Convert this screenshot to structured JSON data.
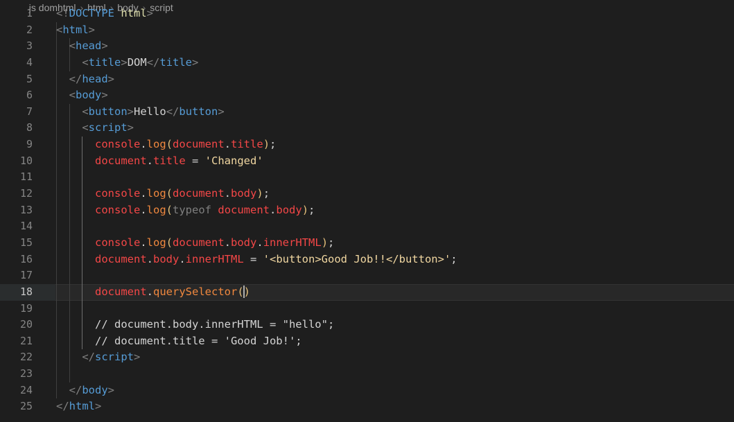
{
  "breadcrumb": {
    "file": "js domhtml",
    "items": [
      "html",
      "body",
      "script"
    ]
  },
  "editor": {
    "lines": [
      {
        "n": "1",
        "tokens": [
          [
            "tag-b",
            "<!"
          ],
          [
            "doctype",
            "DOCTYPE"
          ],
          [
            "txt",
            " "
          ],
          [
            "attr",
            "html"
          ],
          [
            "tag-b",
            ">"
          ]
        ]
      },
      {
        "n": "2",
        "tokens": [
          [
            "tag-b",
            "<"
          ],
          [
            "tag",
            "html"
          ],
          [
            "tag-b",
            ">"
          ]
        ]
      },
      {
        "n": "3",
        "tokens": [
          [
            "txt",
            "  "
          ],
          [
            "tag-b",
            "<"
          ],
          [
            "tag",
            "head"
          ],
          [
            "tag-b",
            ">"
          ]
        ]
      },
      {
        "n": "4",
        "tokens": [
          [
            "txt",
            "    "
          ],
          [
            "tag-b",
            "<"
          ],
          [
            "tag",
            "title"
          ],
          [
            "tag-b",
            ">"
          ],
          [
            "txt",
            "DOM"
          ],
          [
            "tag-b",
            "</"
          ],
          [
            "tag",
            "title"
          ],
          [
            "tag-b",
            ">"
          ]
        ]
      },
      {
        "n": "5",
        "tokens": [
          [
            "txt",
            "  "
          ],
          [
            "tag-b",
            "</"
          ],
          [
            "tag",
            "head"
          ],
          [
            "tag-b",
            ">"
          ]
        ]
      },
      {
        "n": "6",
        "tokens": [
          [
            "txt",
            "  "
          ],
          [
            "tag-b",
            "<"
          ],
          [
            "tag",
            "body"
          ],
          [
            "tag-b",
            ">"
          ]
        ]
      },
      {
        "n": "7",
        "tokens": [
          [
            "txt",
            "    "
          ],
          [
            "tag-b",
            "<"
          ],
          [
            "tag",
            "button"
          ],
          [
            "tag-b",
            ">"
          ],
          [
            "txt",
            "Hello"
          ],
          [
            "tag-b",
            "</"
          ],
          [
            "tag",
            "button"
          ],
          [
            "tag-b",
            ">"
          ]
        ]
      },
      {
        "n": "8",
        "tokens": [
          [
            "txt",
            "    "
          ],
          [
            "tag-b",
            "<"
          ],
          [
            "tag",
            "script"
          ],
          [
            "tag-b",
            ">"
          ]
        ]
      },
      {
        "n": "9",
        "tokens": [
          [
            "txt",
            "      "
          ],
          [
            "var",
            "console"
          ],
          [
            "punc",
            "."
          ],
          [
            "fn",
            "log"
          ],
          [
            "paren",
            "("
          ],
          [
            "var",
            "document"
          ],
          [
            "punc",
            "."
          ],
          [
            "prop",
            "title"
          ],
          [
            "paren",
            ")"
          ],
          [
            "punc",
            ";"
          ]
        ]
      },
      {
        "n": "10",
        "tokens": [
          [
            "txt",
            "      "
          ],
          [
            "var",
            "document"
          ],
          [
            "punc",
            "."
          ],
          [
            "prop",
            "title"
          ],
          [
            "punc",
            " = "
          ],
          [
            "str",
            "'Changed'"
          ]
        ]
      },
      {
        "n": "11",
        "tokens": []
      },
      {
        "n": "12",
        "tokens": [
          [
            "txt",
            "      "
          ],
          [
            "var",
            "console"
          ],
          [
            "punc",
            "."
          ],
          [
            "fn",
            "log"
          ],
          [
            "paren",
            "("
          ],
          [
            "var",
            "document"
          ],
          [
            "punc",
            "."
          ],
          [
            "prop",
            "body"
          ],
          [
            "paren",
            ")"
          ],
          [
            "punc",
            ";"
          ]
        ]
      },
      {
        "n": "13",
        "tokens": [
          [
            "txt",
            "      "
          ],
          [
            "var",
            "console"
          ],
          [
            "punc",
            "."
          ],
          [
            "fn",
            "log"
          ],
          [
            "paren",
            "("
          ],
          [
            "kw",
            "typeof"
          ],
          [
            "txt",
            " "
          ],
          [
            "var",
            "document"
          ],
          [
            "punc",
            "."
          ],
          [
            "prop",
            "body"
          ],
          [
            "paren",
            ")"
          ],
          [
            "punc",
            ";"
          ]
        ]
      },
      {
        "n": "14",
        "tokens": []
      },
      {
        "n": "15",
        "tokens": [
          [
            "txt",
            "      "
          ],
          [
            "var",
            "console"
          ],
          [
            "punc",
            "."
          ],
          [
            "fn",
            "log"
          ],
          [
            "paren",
            "("
          ],
          [
            "var",
            "document"
          ],
          [
            "punc",
            "."
          ],
          [
            "prop",
            "body"
          ],
          [
            "punc",
            "."
          ],
          [
            "prop",
            "innerHTML"
          ],
          [
            "paren",
            ")"
          ],
          [
            "punc",
            ";"
          ]
        ]
      },
      {
        "n": "16",
        "tokens": [
          [
            "txt",
            "      "
          ],
          [
            "var",
            "document"
          ],
          [
            "punc",
            "."
          ],
          [
            "prop",
            "body"
          ],
          [
            "punc",
            "."
          ],
          [
            "prop",
            "innerHTML"
          ],
          [
            "punc",
            " = "
          ],
          [
            "str",
            "'<button>Good Job!!</button>'"
          ],
          [
            "punc",
            ";"
          ]
        ]
      },
      {
        "n": "17",
        "tokens": []
      },
      {
        "n": "18",
        "tokens": [
          [
            "txt",
            "      "
          ],
          [
            "var",
            "document"
          ],
          [
            "punc",
            "."
          ],
          [
            "fn",
            "querySelector"
          ],
          [
            "paren",
            "("
          ],
          [
            "cursor",
            ""
          ],
          [
            "paren",
            ")"
          ]
        ]
      },
      {
        "n": "19",
        "tokens": []
      },
      {
        "n": "20",
        "tokens": [
          [
            "txt",
            "      "
          ],
          [
            "cmt",
            "// document.body.innerHTML = \"hello\";"
          ]
        ]
      },
      {
        "n": "21",
        "tokens": [
          [
            "txt",
            "      "
          ],
          [
            "cmt",
            "// document.title = 'Good Job!';"
          ]
        ]
      },
      {
        "n": "22",
        "tokens": [
          [
            "txt",
            "    "
          ],
          [
            "tag-b",
            "</"
          ],
          [
            "tag",
            "script"
          ],
          [
            "tag-b",
            ">"
          ]
        ]
      },
      {
        "n": "23",
        "tokens": []
      },
      {
        "n": "24",
        "tokens": [
          [
            "txt",
            "  "
          ],
          [
            "tag-b",
            "</"
          ],
          [
            "tag",
            "body"
          ],
          [
            "tag-b",
            ">"
          ]
        ]
      },
      {
        "n": "25",
        "tokens": [
          [
            "tag-b",
            "</"
          ],
          [
            "tag",
            "html"
          ],
          [
            "tag-b",
            ">"
          ]
        ]
      }
    ],
    "current_line": "18"
  }
}
